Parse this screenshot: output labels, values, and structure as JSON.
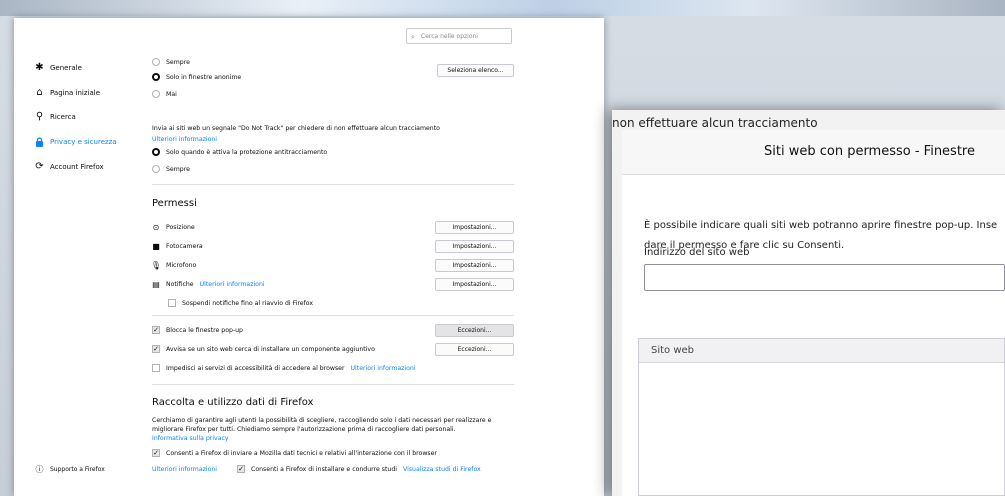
{
  "search": {
    "placeholder": "Cerca nelle opzioni"
  },
  "sidebar": {
    "items": [
      {
        "label": "Generale",
        "icon": "gear-icon"
      },
      {
        "label": "Pagina iniziale",
        "icon": "home-icon"
      },
      {
        "label": "Ricerca",
        "icon": "search-icon"
      },
      {
        "label": "Privacy e sicurezza",
        "icon": "lock-icon"
      },
      {
        "label": "Account Firefox",
        "icon": "sync-icon"
      }
    ],
    "support": "Supporto a Firefox"
  },
  "history_radios": {
    "sempre": "Sempre",
    "solo_anonime": "Solo in finestre anonime",
    "mai": "Mai",
    "select_btn": "Seleziona elenco..."
  },
  "dnt": {
    "text": "Invia ai siti web un segnale \"Do Not Track\" per chiedere di non effettuare alcun tracciamento",
    "link": "Ulteriori informazioni",
    "opt_solo": "Solo quando è attiva la protezione antitracciamento",
    "opt_sempre": "Sempre"
  },
  "permessi": {
    "title": "Permessi",
    "items": [
      {
        "label": "Posizione",
        "button": "Impostazioni..."
      },
      {
        "label": "Fotocamera",
        "button": "Impostazioni..."
      },
      {
        "label": "Microfono",
        "button": "Impostazioni..."
      },
      {
        "label": "Notifiche",
        "link": "Ulteriori informazioni",
        "button": "Impostazioni..."
      }
    ],
    "sospendi": "Sospendi notifiche fino al riavvio di Firefox",
    "blocca_popup": "Blocca le finestre pop-up",
    "avvisa": "Avvisa se un sito web cerca di installare un componente aggiuntivo",
    "eccezioni": "Eccezioni...",
    "impedisci": "Impedisci ai servizi di accessibilità di accedere al browser",
    "impedisci_link": "Ulteriori informazioni"
  },
  "raccolta": {
    "title": "Raccolta e utilizzo dati di Firefox",
    "desc1": "Cerchiamo di garantire agli utenti la possibilità di scegliere, raccogliendo solo i dati necessari per realizzare e",
    "desc2": "migliorare Firefox per tutti. Chiediamo sempre l'autorizzazione prima di raccogliere dati personali.",
    "privacy_link": "Informativa sulla privacy",
    "consenti_tecnici": "Consenti a Firefox di inviare a Mozilla dati tecnici e relativi all'interazione con il browser",
    "ulteriori": "Ulteriori informazioni",
    "consenti_studi": "Consenti a Firefox di installare e condurre studi",
    "visualizza_studi": "Visualizza studi di Firefox"
  },
  "dialog": {
    "behind_text": "non effettuare alcun tracciamento",
    "title": "Siti web con permesso - Finestre",
    "desc1": "È possibile indicare quali siti web potranno aprire finestre pop-up. Inse",
    "desc2": "dare il permesso e fare clic su Consenti.",
    "address_label": "Indirizzo del sito web",
    "column_site": "Sito web"
  },
  "colors": {
    "accent": "#0a84ff",
    "text": "#0c0c0d"
  }
}
